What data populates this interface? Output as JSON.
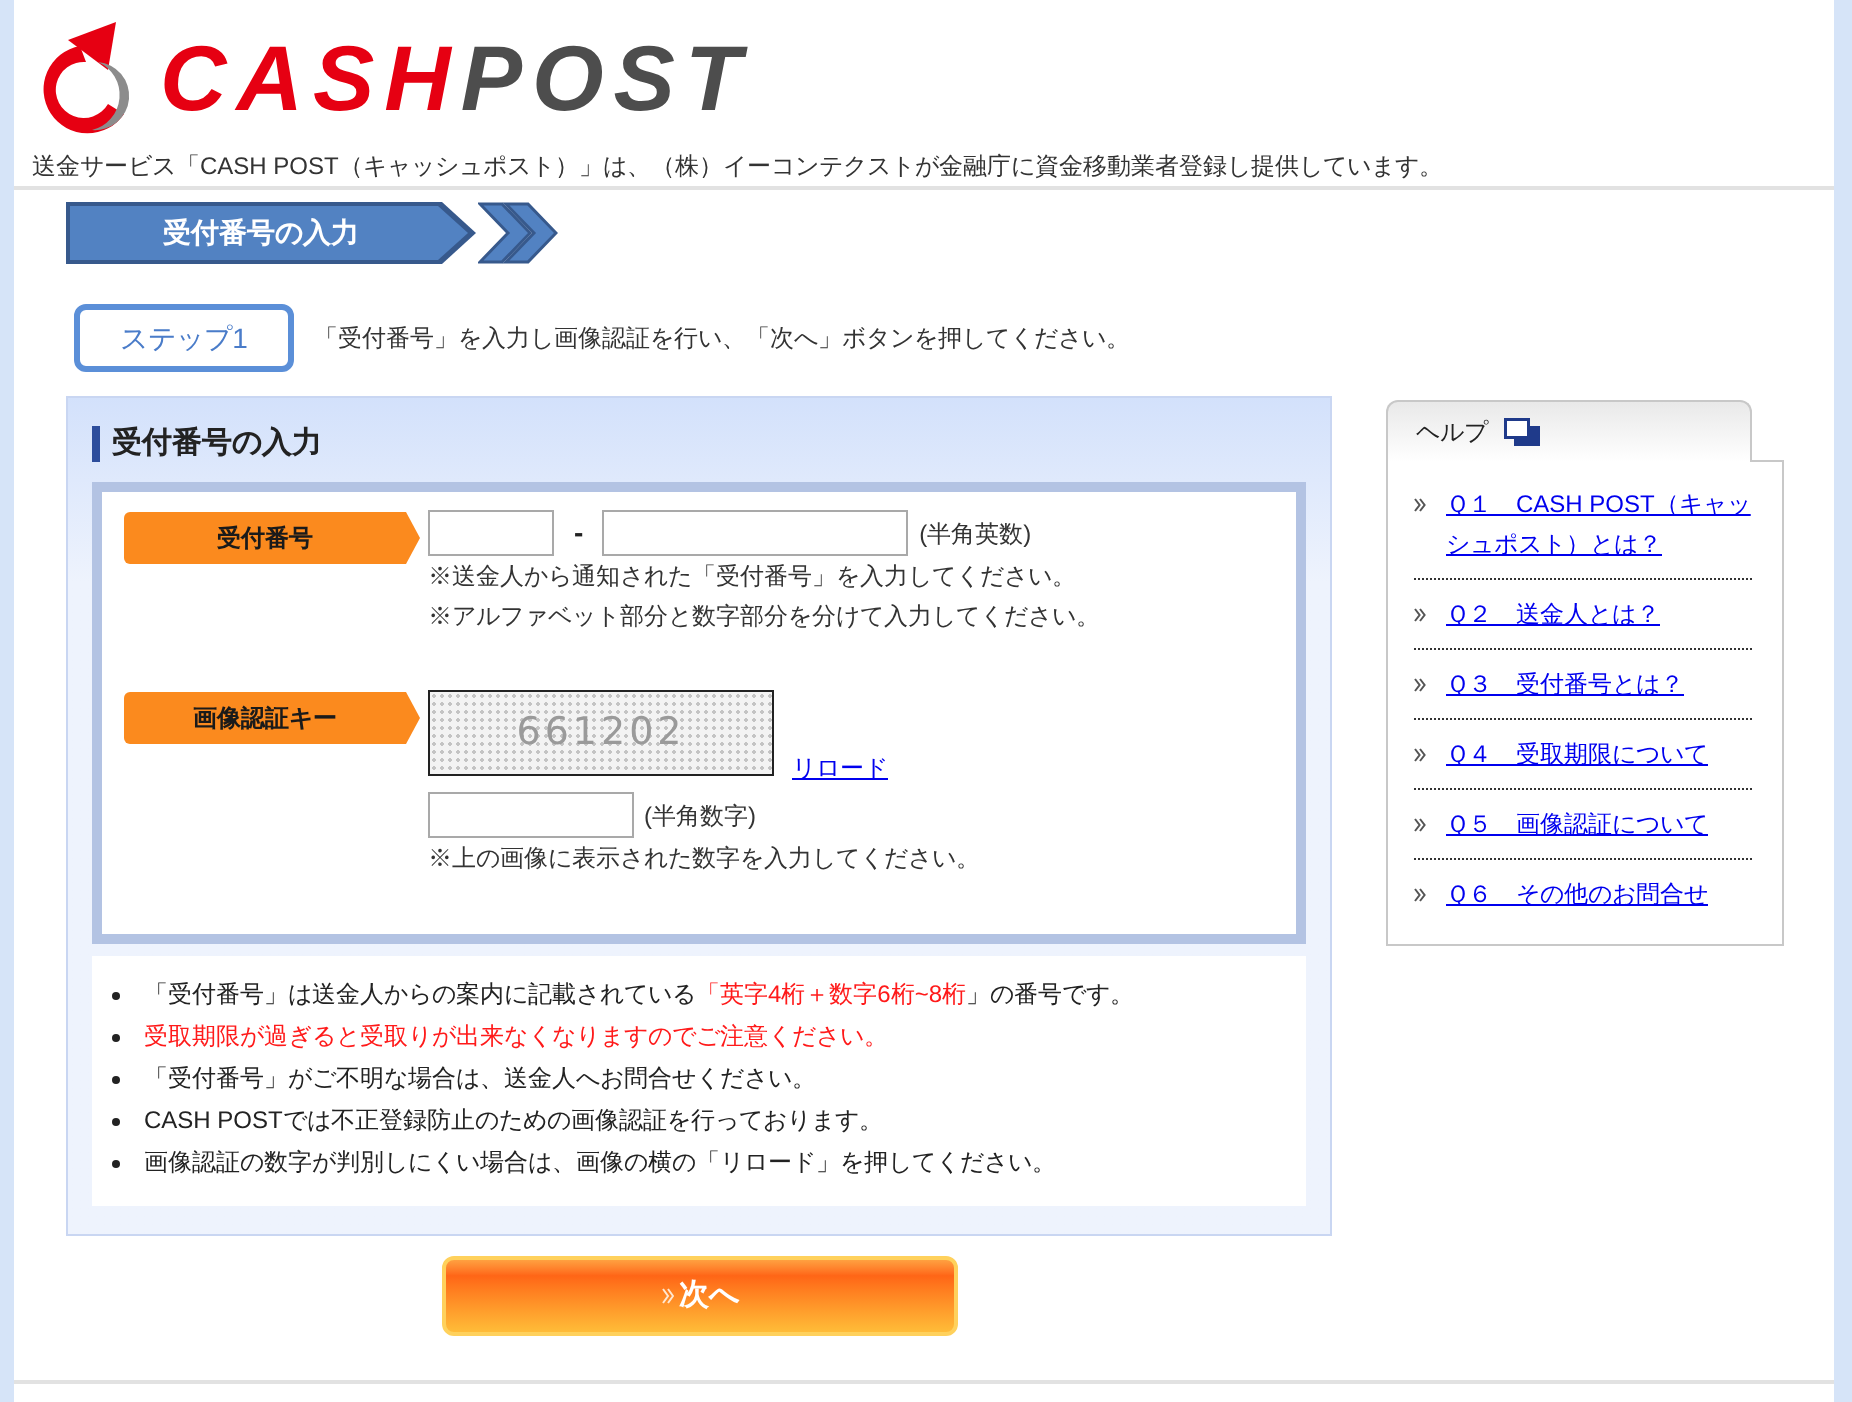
{
  "header": {
    "logo": [
      "CASH",
      "POST"
    ],
    "tagline": "送金サービス「CASH POST（キャッシュポスト）」は、（株）イーコンテクストが金融庁に資金移動業者登録し提供しています。"
  },
  "step_banner": {
    "title": "受付番号の入力"
  },
  "step": {
    "badge": "ステップ1",
    "instruction": "「受付番号」を入力し画像認証を行い、「次へ」ボタンを押してください。"
  },
  "form_panel": {
    "title": "受付番号の入力",
    "fields": [
      {
        "kind": "text_pair",
        "label": "受付番号",
        "separator": "-",
        "hint": "(半角英数)",
        "notes": [
          "※送金人から通知された「受付番号」を入力してください。",
          "※アルファベット部分と数字部分を分けて入力してください。"
        ]
      },
      {
        "kind": "captcha",
        "label": "画像認証キー",
        "captcha_text": "661202",
        "reload_link": "リロード",
        "hint": "(半角数字)",
        "notes": [
          "※上の画像に表示された数字を入力してください。"
        ]
      }
    ],
    "notes": [
      {
        "segments": [
          {
            "text": "「受付番号」は送金人からの案内に記載されている",
            "emphasis": false
          },
          {
            "text": "「英字4桁＋数字6桁~8桁",
            "emphasis": true
          },
          {
            "text": "」の番号です。",
            "emphasis": false
          }
        ]
      },
      {
        "segments": [
          {
            "text": "受取期限が過ぎると受取りが出来なくなりますのでご注意ください。",
            "emphasis": true
          }
        ]
      },
      {
        "segments": [
          {
            "text": "「受付番号」がご不明な場合は、送金人へお問合せください。",
            "emphasis": false
          }
        ]
      },
      {
        "segments": [
          {
            "text": "CASH POSTでは不正登録防止のための画像認証を行っております。",
            "emphasis": false
          }
        ]
      },
      {
        "segments": [
          {
            "text": "画像認証の数字が判別しにくい場合は、画像の横の「リロード」を押してください。",
            "emphasis": false
          }
        ]
      }
    ]
  },
  "next_button": {
    "label": "次へ"
  },
  "help": {
    "title": "ヘルプ",
    "items": [
      "Ｑ１　CASH POST（キャッシュポスト）とは？",
      "Ｑ２　送金人とは？",
      "Ｑ３　受付番号とは？",
      "Ｑ４　受取期限について",
      "Ｑ５　画像認証について",
      "Ｑ６　その他のお問合せ"
    ]
  }
}
